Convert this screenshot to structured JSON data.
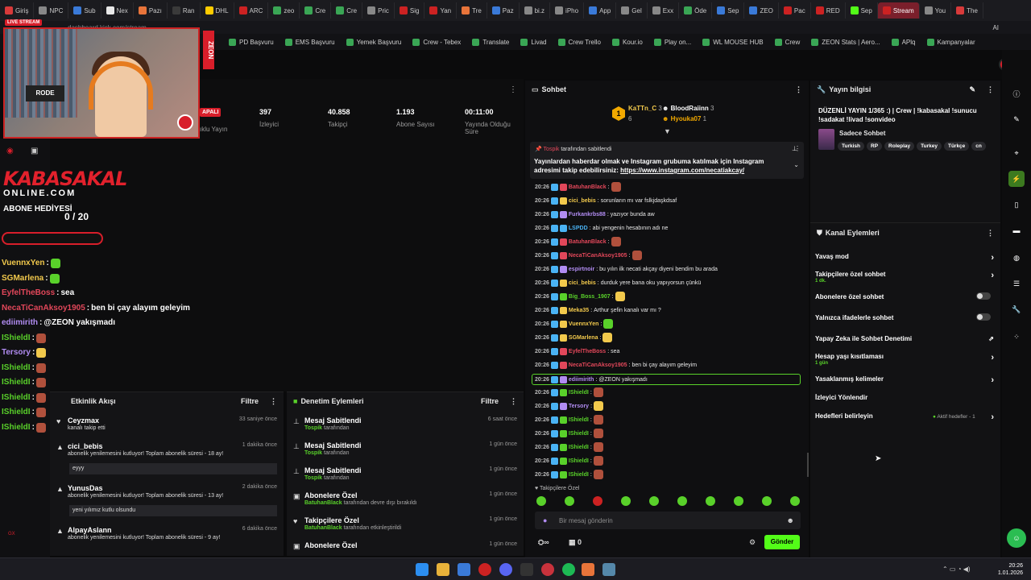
{
  "browser": {
    "tabs": [
      "Giriş",
      "NPC",
      "Sub",
      "Nex",
      "Pazı",
      "Ran",
      "DHL",
      "ARC",
      "zeo",
      "Cre",
      "Cre",
      "Pric",
      "Sig",
      "Yan",
      "Tre",
      "Paz",
      "bi.z",
      "iPho",
      "App",
      "Gel",
      "Exx",
      "Öde",
      "Sep",
      "ZEO",
      "Pac",
      "RED",
      "Sep",
      "Stream",
      "You",
      "The"
    ],
    "active_tab": "Stream",
    "url": "dashboard.kick.com/stream",
    "bookmarks": [
      "PD Başvuru",
      "EMS Başvuru",
      "Yemek Başvuru",
      "Crew - Tebex",
      "Translate",
      "Livad",
      "Crew Trello",
      "Kour.io",
      "Play on...",
      "WL MOUSE HUB",
      "Crew",
      "ZEON Stats | Aero...",
      "APlq",
      "Kampanyalar"
    ]
  },
  "webcam": {
    "live_badge": "LIVE STREAM",
    "chair_text": "RODE",
    "side_text": "ZEON"
  },
  "overlay": {
    "logo_line1": "KABASAKAL",
    "logo_line2": "ONLINE.COM",
    "sub_goal_label": "ABONE HEDİYESİ",
    "sub_goal_count": "0 / 20",
    "sub_goal_progress": 0,
    "chat": [
      {
        "user": "VuennxYen",
        "color": "#f2c94c",
        "msg": ""
      },
      {
        "user": "SGMarlena",
        "color": "#f2c94c",
        "msg": ""
      },
      {
        "user": "EyfelTheBoss",
        "color": "#e2475a",
        "msg": "sea"
      },
      {
        "user": "NecaTiCanAksoy1905",
        "color": "#e2475a",
        "msg": "ben bi çay alayım geleyim"
      },
      {
        "user": "ediimirith",
        "color": "#b18cf2",
        "msg": "@ZEON yakışmadı"
      },
      {
        "user": "IShieldI",
        "color": "#59d12a",
        "msg": ""
      },
      {
        "user": "Tersory",
        "color": "#b18cf2",
        "msg": ""
      },
      {
        "user": "IShieldI",
        "color": "#59d12a",
        "msg": ""
      },
      {
        "user": "IShieldI",
        "color": "#59d12a",
        "msg": ""
      },
      {
        "user": "IShieldI",
        "color": "#59d12a",
        "msg": ""
      },
      {
        "user": "IShieldI",
        "color": "#59d12a",
        "msg": ""
      },
      {
        "user": "IShieldI",
        "color": "#59d12a",
        "msg": ""
      }
    ]
  },
  "stats": {
    "status_badge": "APALI",
    "status_label": "ıklu Yayın",
    "items": [
      {
        "value": "397",
        "label": "İzleyici"
      },
      {
        "value": "40.858",
        "label": "Takipçi"
      },
      {
        "value": "1.193",
        "label": "Abone Sayısı"
      },
      {
        "value": "00:11:00",
        "label": "Yayında Olduğu Süre"
      }
    ]
  },
  "activity_feed": {
    "title": "Etkinlik Akışı",
    "filter": "Filtre",
    "items": [
      {
        "user": "Ceyzmax",
        "desc": "kanalı takip etti",
        "time": "33 saniye önce",
        "box": ""
      },
      {
        "user": "cici_bebis",
        "desc": "abonelik yenilemesini kutluyor! Toplam abonelik süresi - 18 ay!",
        "time": "1 dakika önce",
        "box": "eyyy"
      },
      {
        "user": "YunusDas",
        "desc": "abonelik yenilemesini kutluyor! Toplam abonelik süresi - 13 ay!",
        "time": "2 dakika önce",
        "box": "yeni yılımız kutlu olsundu"
      },
      {
        "user": "AlpayAslann",
        "desc": "abonelik yenilemesini kutluyor! Toplam abonelik süresi - 9 ay!",
        "time": "6 dakika önce",
        "box": ""
      }
    ]
  },
  "mod_actions": {
    "title": "Denetim Eylemleri",
    "filter": "Filtre",
    "items": [
      {
        "title": "Mesaj Sabitlendi",
        "user": "Tospik",
        "suffix": "tarafından",
        "time": "6 saat önce"
      },
      {
        "title": "Mesaj Sabitlendi",
        "user": "Tospik",
        "suffix": "tarafından",
        "time": "1 gün önce"
      },
      {
        "title": "Mesaj Sabitlendi",
        "user": "Tospik",
        "suffix": "tarafından",
        "time": "1 gün önce"
      },
      {
        "title": "Abonelere Özel",
        "user": "BatuhanBlack",
        "suffix": "tarafından devre dışı bırakıldı",
        "time": "1 gün önce"
      },
      {
        "title": "Takipçilere Özel",
        "user": "BatuhanBlack",
        "suffix": "tarafından etkinleştirildi",
        "time": "1 gün önce"
      },
      {
        "title": "Abonelere Özel",
        "user": "",
        "suffix": "",
        "time": "1 gün önce"
      }
    ]
  },
  "chat": {
    "title": "Sohbet",
    "top_gifters": [
      {
        "rank": "1",
        "name": "KaTTn_C",
        "count": "3"
      },
      {
        "rank": "",
        "name": "BloodRaiinn",
        "count": "3"
      },
      {
        "rank": "",
        "name": "Hyouka07",
        "count": "1"
      },
      {
        "rank": "",
        "name": "",
        "count": "6"
      }
    ],
    "pinned_by": "Tospik",
    "pinned_suffix": "tarafından sabitlendi",
    "pinned_text": "Yayınlardan haberdar olmak ve Instagram grubuma katılmak için Instagram adresimi takip edebilirsiniz:",
    "pinned_link": "https://www.instagram.com/necatiakcay/",
    "messages": [
      {
        "time": "20:26",
        "user": "BatuhanBlack",
        "color": "#e2475a",
        "msg": ""
      },
      {
        "time": "20:26",
        "user": "cici_bebis",
        "color": "#f2c94c",
        "msg": "sorunların mı var fslkjdaşkdsaf"
      },
      {
        "time": "20:26",
        "user": "Furkankrbs88",
        "color": "#b18cf2",
        "msg": "yazıyor bunda aw"
      },
      {
        "time": "20:26",
        "user": "LSPDD",
        "color": "#4ab3f4",
        "msg": "abi yengenin hesabının adı ne"
      },
      {
        "time": "20:26",
        "user": "BatuhanBlack",
        "color": "#e2475a",
        "msg": ""
      },
      {
        "time": "20:26",
        "user": "NecaTiCanAksoy1905",
        "color": "#e2475a",
        "msg": ""
      },
      {
        "time": "20:26",
        "user": "espirtnoir",
        "color": "#b18cf2",
        "msg": "bu yılın ilk necati akçay diyeni bendim bu arada"
      },
      {
        "time": "20:26",
        "user": "cici_bebis",
        "color": "#f2c94c",
        "msg": "durduk yere bana oku yapıyorsun çünkü"
      },
      {
        "time": "20:26",
        "user": "Big_Boss_1907",
        "color": "#59d12a",
        "msg": ""
      },
      {
        "time": "20:26",
        "user": "Meka35",
        "color": "#f2c94c",
        "msg": "Arthur şefin kanalı var mı ?"
      },
      {
        "time": "20:26",
        "user": "VuennxYen",
        "color": "#f2c94c",
        "msg": ""
      },
      {
        "time": "20:26",
        "user": "SGMarlena",
        "color": "#f2c94c",
        "msg": ""
      },
      {
        "time": "20:26",
        "user": "EyfelTheBoss",
        "color": "#e2475a",
        "msg": "sea"
      },
      {
        "time": "20:26",
        "user": "NecaTiCanAksoy1905",
        "color": "#e2475a",
        "msg": "ben bi çay alayım geleyim"
      },
      {
        "time": "20:26",
        "user": "ediimirith",
        "color": "#b18cf2",
        "msg": "@ZEON yakışmadı",
        "highlight": true
      },
      {
        "time": "20:26",
        "user": "IShieldI",
        "color": "#59d12a",
        "msg": ""
      },
      {
        "time": "20:26",
        "user": "Tersory",
        "color": "#b18cf2",
        "msg": ""
      },
      {
        "time": "20:26",
        "user": "IShieldI",
        "color": "#59d12a",
        "msg": ""
      },
      {
        "time": "20:26",
        "user": "IShieldI",
        "color": "#59d12a",
        "msg": ""
      },
      {
        "time": "20:26",
        "user": "IShieldI",
        "color": "#59d12a",
        "msg": ""
      },
      {
        "time": "20:26",
        "user": "IShieldI",
        "color": "#59d12a",
        "msg": ""
      },
      {
        "time": "20:26",
        "user": "IShieldI",
        "color": "#59d12a",
        "msg": ""
      }
    ],
    "mode_label": "Takipçilere Özel",
    "input_placeholder": "Bir mesaj gönderin",
    "send_label": "Gönder",
    "bottom_count": "0",
    "bottom_infinity": "∞"
  },
  "stream_info": {
    "title": "Yayın bilgisi",
    "stream_title": "DÜZENLİ YAYIN 1/365 :) | Crew | !kabasakal !sunucu !sadakat !livad !sonvideo",
    "category": "Sadece Sohbet",
    "tags": [
      "Turkish",
      "RP",
      "Roleplay",
      "Turkey",
      "Türkçe",
      "cn"
    ]
  },
  "channel_actions": {
    "title": "Kanal Eylemleri",
    "items": [
      {
        "label": "Yavaş mod",
        "sub": "",
        "control": "chevron"
      },
      {
        "label": "Takipçilere özel sohbet",
        "sub": "1 dk.",
        "control": "chevron"
      },
      {
        "label": "Abonelere özel sohbet",
        "sub": "",
        "control": "toggle"
      },
      {
        "label": "Yalnızca ifadelerle sohbet",
        "sub": "",
        "control": "toggle"
      },
      {
        "label": "Yapay Zeka ile Sohbet Denetimi",
        "sub": "",
        "control": "external"
      },
      {
        "label": "Hesap yaşı kısıtlaması",
        "sub": "1 gün",
        "control": "chevron"
      },
      {
        "label": "Yasaklanmış kelimeler",
        "sub": "",
        "control": "chevron"
      },
      {
        "label": "İzleyici Yönlendir",
        "sub": "",
        "control": ""
      },
      {
        "label": "Hedefleri belirleyin",
        "sub": "",
        "control": "chevron"
      }
    ],
    "goals_status": "Aktif hedefler - 1"
  },
  "taskbar": {
    "time": "20:26",
    "date": "1.01.2026"
  }
}
